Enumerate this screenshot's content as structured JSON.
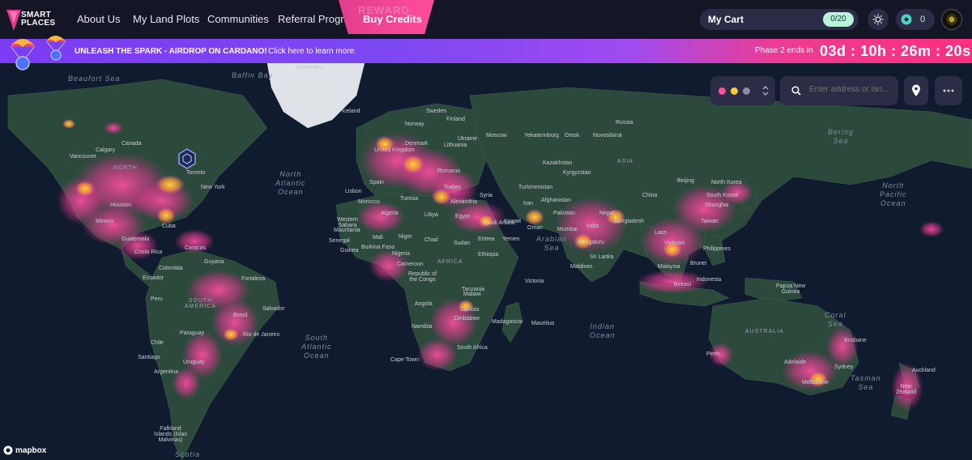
{
  "header": {
    "logo_line1": "SMART",
    "logo_line2": "PLACES",
    "nav": [
      {
        "label": "About Us"
      },
      {
        "label": "My Land Plots"
      },
      {
        "label": "Communities"
      },
      {
        "label": "Referral Program"
      }
    ],
    "buy_credits": "Buy Credits",
    "buy_credits_ghost": "REWARD",
    "cart_label": "My Cart",
    "cart_count": "0/20",
    "credits_count": "0"
  },
  "banner": {
    "title": "UNLEASH THE SPARK - AIRDROP ON CARDANO!",
    "link": "Click here to learn more.",
    "phase_label": "Phase 2 ends in",
    "countdown": "03d : 10h : 26m : 20s"
  },
  "map_controls": {
    "search_placeholder": "Enter address or lan...",
    "filter_dot_colors": [
      "#ff4fa3",
      "#ffcc33",
      "#8b8fa3"
    ]
  },
  "map_labels": {
    "oceans": [
      "North\nAtlantic\nOcean",
      "South\nAtlantic\nOcean",
      "Indian\nOcean",
      "North\nPacific\nOcean",
      "Arabian\nSea",
      "Coral\nSea",
      "Tasman\nSea",
      "Bering\nSea",
      "Beaufort Sea",
      "Baffin Bay",
      "Scotia"
    ],
    "countries": [
      "SOUTH\nAMERICA",
      "AFRICA",
      "ASIA",
      "AUSTRALIA",
      "NORTH"
    ],
    "places": [
      "Greenland",
      "Iceland",
      "Sweden",
      "Finland",
      "Norway",
      "Russia",
      "Yekaterinburg",
      "Omsk",
      "Novosibirsk",
      "Moscow",
      "Ukraine",
      "Denmark",
      "United Kingdom",
      "Lithuania",
      "Romania",
      "Turkey",
      "Kazakhstan",
      "Kyrgyzstan",
      "Turkmenistan",
      "Afghanistan",
      "Pakistan",
      "India",
      "Bangladesh",
      "China",
      "Beijing",
      "North Korea",
      "South Korea",
      "Shanghai",
      "Taiwan",
      "Laos",
      "Vietnam",
      "Philippines",
      "Brunei",
      "Malaysia",
      "Bekasi",
      "Indonesia",
      "Papua New\nGuinea",
      "Brisbane",
      "Sydney",
      "Adelaide",
      "Melbourne",
      "Perth",
      "Auckland",
      "New\nZealand",
      "Spain",
      "Lisbon",
      "Morocco",
      "Tunisia",
      "Algeria",
      "Libya",
      "Egypt",
      "Alexandria",
      "Syria",
      "Iran",
      "Saudi Arabia",
      "Kuwait",
      "Oman",
      "Yemen",
      "Eritrea",
      "Sudan",
      "Chad",
      "Niger",
      "Mali",
      "Mauritania",
      "Western\nSahara",
      "Senegal",
      "Guinea",
      "Burkina Faso",
      "Nigeria",
      "Cameroon",
      "Republic of\nthe Congo",
      "Ethiopia",
      "Tanzania",
      "Angola",
      "Zambia",
      "Malawi",
      "Zimbabwe",
      "Namibia",
      "Madagascar",
      "Mauritius",
      "South Africa",
      "Cape Town",
      "Victoria",
      "Maldives",
      "Sri Lanka",
      "Mumbai",
      "Bengaluru",
      "Nepal",
      "Canada",
      "Calgary",
      "Vancouver",
      "Toronto",
      "New York",
      "Houston",
      "Mexico",
      "Cuba",
      "Guatemala",
      "Costa Rica",
      "Caracas",
      "Guyana",
      "Colombia",
      "Ecuador",
      "Peru",
      "Brasil",
      "Fortaleza",
      "Salvador",
      "Rio de Janeiro",
      "Paraguay",
      "Chile",
      "Santiago",
      "Uruguay",
      "Argentina",
      "Falkland\nIslands (Islas\nMalvinas)"
    ],
    "attribution": "mapbox"
  }
}
